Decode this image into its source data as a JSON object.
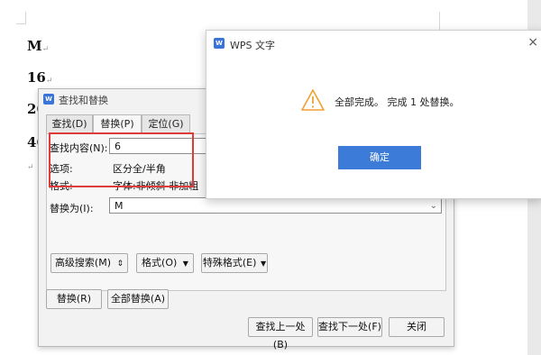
{
  "document": {
    "lines": [
      "M",
      "16",
      "26",
      "46"
    ],
    "paragraph_mark": "↵"
  },
  "find_replace": {
    "title": "查找和替换",
    "tabs": [
      {
        "label": "查找(D)",
        "active": false
      },
      {
        "label": "替换(P)",
        "active": true
      },
      {
        "label": "定位(G)",
        "active": false
      }
    ],
    "find_label": "查找内容(N):",
    "find_value": "6",
    "options_label": "选项:",
    "options_value": "区分全/半角",
    "format_label": "格式:",
    "format_value": "字体:非倾斜 非加粗",
    "replace_label": "替换为(I):",
    "replace_value": "M",
    "buttons": {
      "advanced": "高级搜索(M)",
      "format": "格式(O)",
      "special": "特殊格式(E)",
      "replace": "替换(R)",
      "replace_all": "全部替换(A)",
      "find_prev": "查找上一处(B)",
      "find_next": "查找下一处(F)",
      "close": "关闭"
    }
  },
  "alert": {
    "title": "WPS 文字",
    "message": "全部完成。 完成 1 处替换。",
    "ok": "确定",
    "close_glyph": "×"
  },
  "colors": {
    "accent": "#3c7bd8",
    "highlight": "#e03b3b",
    "warning": "#f0a030"
  }
}
